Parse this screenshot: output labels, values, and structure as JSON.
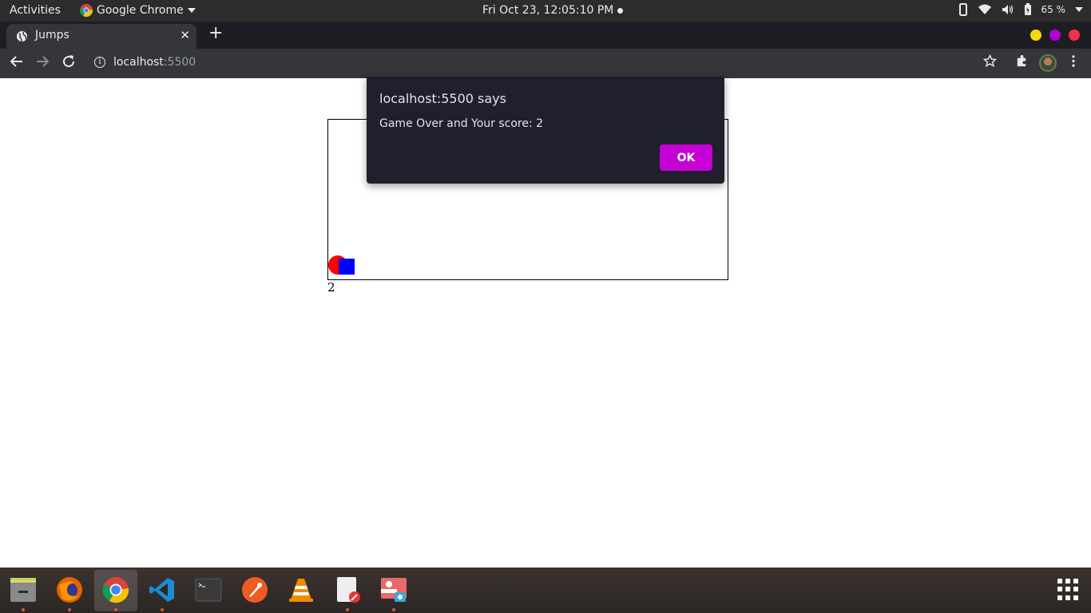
{
  "topbar": {
    "activities": "Activities",
    "app_name": "Google Chrome",
    "clock": "Fri Oct 23, 12:05:10 PM",
    "battery": "65 %"
  },
  "browser": {
    "tab_title": "Jumps",
    "url_host": "localhost",
    "url_port": ":5500"
  },
  "dialog": {
    "title": "localhost:5500 says",
    "message": "Game Over and Your score: 2",
    "ok_label": "OK"
  },
  "page": {
    "score": "2"
  },
  "colors": {
    "player": "#ff0000",
    "obstacle": "#0000ff",
    "ok_button": "#c700d6",
    "window_dots": [
      "#f5d90a",
      "#b400d6",
      "#f0304c"
    ]
  },
  "dock": {
    "apps": [
      "files-icon",
      "firefox-icon",
      "chrome-icon",
      "vscode-icon",
      "terminal-icon",
      "postman-icon",
      "vlc-icon",
      "text-editor-icon",
      "screenshot-icon"
    ]
  }
}
